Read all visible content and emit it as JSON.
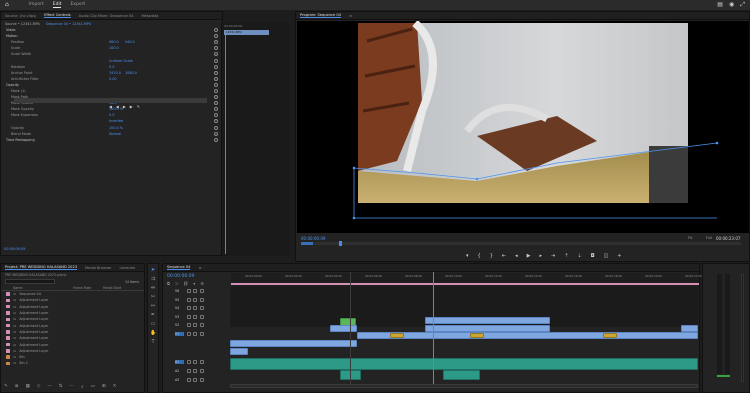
{
  "topbar": {
    "nav": [
      "Import",
      "Edit",
      "Export"
    ],
    "active": "Edit"
  },
  "effect_controls": {
    "tabs": [
      "Source: (no clips)",
      "Effect Controls",
      "Audio Clip Mixer: Sequence 04",
      "Metadata"
    ],
    "source_label": "Source • 12341.MP4",
    "clip_label": "Sequence 04 • 12341.MP4",
    "sections": [
      {
        "kind": "sec",
        "label": "Video"
      },
      {
        "kind": "sec",
        "label": "Motion"
      },
      {
        "kind": "row",
        "label": "Position",
        "v1": "960.0",
        "v2": "540.0"
      },
      {
        "kind": "row",
        "label": "Scale",
        "v1": "100.0",
        "v2": ""
      },
      {
        "kind": "row",
        "label": "Scale Width",
        "v1": "",
        "v2": ""
      },
      {
        "kind": "row",
        "label": "",
        "v1": "Uniform Scale",
        "v2": ""
      },
      {
        "kind": "row",
        "label": "Rotation",
        "v1": "0.0",
        "v2": ""
      },
      {
        "kind": "row",
        "label": "Anchor Point",
        "v1": "1920.0",
        "v2": "1080.0"
      },
      {
        "kind": "row",
        "label": "Anti-flicker Filter",
        "v1": "0.00",
        "v2": ""
      },
      {
        "kind": "sec",
        "label": "Opacity"
      },
      {
        "kind": "row",
        "label": "Mask (1)",
        "v1": "",
        "v2": ""
      },
      {
        "kind": "row",
        "label": "Mask Path",
        "v1": "",
        "v2": ""
      },
      {
        "kind": "row",
        "label": "Mask Feather",
        "v1": "10.0",
        "v2": ""
      },
      {
        "kind": "row",
        "label": "Mask Opacity",
        "v1": "100.0 %",
        "v2": ""
      },
      {
        "kind": "row",
        "label": "Mask Expansion",
        "v1": "0.0",
        "v2": ""
      },
      {
        "kind": "row",
        "label": "",
        "v1": "Inverted",
        "v2": ""
      },
      {
        "kind": "row",
        "label": "Opacity",
        "v1": "100.0 %",
        "v2": ""
      },
      {
        "kind": "row",
        "label": "Blend Mode",
        "v1": "Normal",
        "v2": ""
      },
      {
        "kind": "sec",
        "label": "Time Remapping"
      }
    ],
    "mini_timecode": "00:00:00:00",
    "mini_clip": "12341.MP4",
    "bottom_timecode": "00:00:06:09"
  },
  "program": {
    "title": "Program: Sequence 04",
    "timecode": "00:00:06:09",
    "fit": "Fit",
    "quality": "Full",
    "duration": "00:00:23:07"
  },
  "project": {
    "tabs": [
      "Project: PRE WEDDING HALASAND 2023",
      "Media Browser",
      "Libraries"
    ],
    "path": "PRE WEDDING HALASAND 2023.prproj",
    "count": "14 Items",
    "columns": [
      "Name",
      "Frame Rate",
      "Media Start"
    ],
    "items": [
      {
        "name": "Sequence 04",
        "color": "#d48fb5"
      },
      {
        "name": "Adjustment Layer",
        "color": "#d48fb5"
      },
      {
        "name": "Adjustment Layer",
        "color": "#d48fb5"
      },
      {
        "name": "Adjustment Layer",
        "color": "#d48fb5"
      },
      {
        "name": "Adjustment Layer",
        "color": "#d48fb5"
      },
      {
        "name": "Adjustment Layer",
        "color": "#d48fb5"
      },
      {
        "name": "Adjustment Layer",
        "color": "#d48fb5"
      },
      {
        "name": "Adjustment Layer",
        "color": "#d48fb5"
      },
      {
        "name": "Adjustment Layer",
        "color": "#d48fb5"
      },
      {
        "name": "Adjustment Layer",
        "color": "#d48fb5"
      },
      {
        "name": "Bin",
        "color": "#c78a4a"
      },
      {
        "name": "Bin 2",
        "color": "#c78a4a"
      }
    ]
  },
  "timeline": {
    "tab": "Sequence 04",
    "timecode": "00:00:06:09",
    "ruler": [
      "00:00:00:00",
      "00:00:02:00",
      "00:00:04:00",
      "00:00:06:00",
      "00:00:08:00",
      "00:00:10:00",
      "00:00:12:00",
      "00:00:14:00",
      "00:00:16:00",
      "00:00:18:00",
      "00:00:20:00",
      "00:00:22:00"
    ],
    "tracks": [
      "V6",
      "V5",
      "V4",
      "V3",
      "V2",
      "V1",
      "A1",
      "A2",
      "A3"
    ]
  },
  "colors": {
    "accent": "#4c94f0",
    "clip_blue": "#7ea6df",
    "clip_green": "#5bb55a",
    "audio_teal": "#2d9a88",
    "playhead": "#4a8be8"
  }
}
